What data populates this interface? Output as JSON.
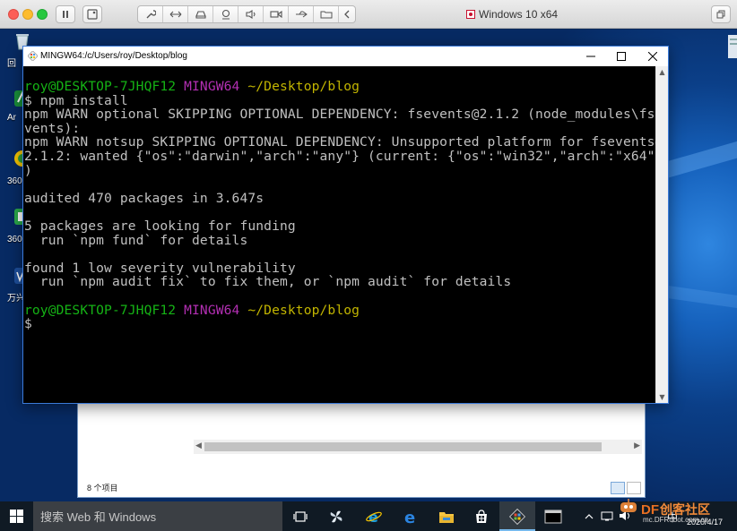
{
  "host": {
    "window_title": "Windows 10 x64",
    "toolbar_buttons": [
      "pause",
      "screenshot",
      "settings",
      "resize",
      "drive",
      "camera-device",
      "audio",
      "video",
      "usb",
      "shared-folders",
      "back"
    ]
  },
  "desktop": {
    "icons": [
      {
        "label": "回",
        "icon": "recycle-bin-icon"
      },
      {
        "label": "Ar",
        "icon": "app-icon"
      },
      {
        "label": "360安",
        "icon": "360-safe-icon"
      },
      {
        "label": "360软",
        "icon": "360-software-icon"
      },
      {
        "label": "万兴F",
        "icon": "wondershare-icon"
      }
    ]
  },
  "explorer": {
    "status_text": "8 个项目"
  },
  "terminal": {
    "title": "MINGW64:/c/Users/roy/Desktop/blog",
    "prompt_user": "roy@DESKTOP-7JHQF12",
    "prompt_env": "MINGW64",
    "prompt_path": "~/Desktop/blog",
    "lines": {
      "l1": "$ npm install",
      "l2": "npm WARN optional SKIPPING OPTIONAL DEPENDENCY: fsevents@2.1.2 (node_modules\\fse",
      "l3": "vents):",
      "l4": "npm WARN notsup SKIPPING OPTIONAL DEPENDENCY: Unsupported platform for fsevents@",
      "l5": "2.1.2: wanted {\"os\":\"darwin\",\"arch\":\"any\"} (current: {\"os\":\"win32\",\"arch\":\"x64\"}",
      "l6": ")",
      "l7": "",
      "l8": "audited 470 packages in 3.647s",
      "l9": "",
      "l10": "5 packages are looking for funding",
      "l11": "  run `npm fund` for details",
      "l12": "",
      "l13": "found 1 low severity vulnerability",
      "l14": "  run `npm audit fix` to fix them, or `npm audit` for details",
      "l15": "",
      "l17": "$"
    }
  },
  "taskbar": {
    "search_placeholder": "搜索 Web 和 Windows",
    "ime": "中",
    "date": "2020/4/17",
    "pinned": [
      "task-view-icon",
      "pinwheel-icon",
      "ie-icon",
      "edge-icon",
      "file-explorer-icon",
      "store-icon",
      "git-bash-icon",
      "terminal-icon"
    ]
  },
  "watermark": {
    "brand": "DF",
    "name": "创客社区",
    "sub": "mc.DFRobot.com.cn"
  },
  "colors": {
    "prompt_user": "#15b315",
    "prompt_env": "#b32fb3",
    "prompt_path": "#c2b500",
    "terminal_bg": "#000000",
    "terminal_text": "#c0c0c0",
    "taskbar": "#101a24"
  }
}
